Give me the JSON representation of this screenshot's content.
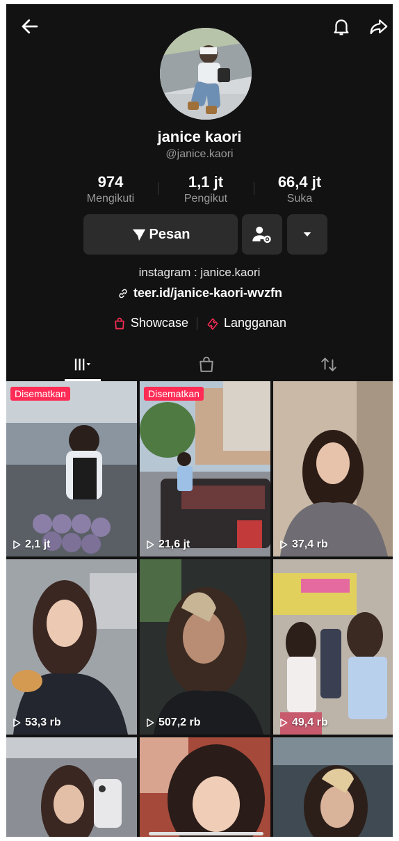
{
  "profile": {
    "name": "janice kaori",
    "handle": "@janice.kaori",
    "bio": "instagram : janice.kaori",
    "link": "teer.id/janice-kaori-wvzfn"
  },
  "stats": [
    {
      "value": "974",
      "label": "Mengikuti"
    },
    {
      "value": "1,1 jt",
      "label": "Pengikut"
    },
    {
      "value": "66,4 jt",
      "label": "Suka"
    }
  ],
  "actions": {
    "message": "Pesan"
  },
  "shop": {
    "showcase": "Showcase",
    "subscription": "Langganan"
  },
  "videos": [
    {
      "views": "2,1 jt",
      "pinned": "Disematkan"
    },
    {
      "views": "21,6 jt",
      "pinned": "Disematkan"
    },
    {
      "views": "37,4 rb"
    },
    {
      "views": "53,3 rb"
    },
    {
      "views": "507,2 rb"
    },
    {
      "views": "49,4 rb"
    },
    {
      "views": ""
    },
    {
      "views": ""
    },
    {
      "views": ""
    }
  ],
  "colors": {
    "background": "#121212",
    "accent": "#fe2c55",
    "button": "#2c2c2c"
  },
  "icons": [
    "back-arrow-icon",
    "bell-icon",
    "share-icon",
    "send-icon",
    "add-friend-icon",
    "chevron-down-icon",
    "link-icon",
    "shopping-bag-icon",
    "ticket-icon",
    "grid-icon",
    "repost-icon",
    "play-icon"
  ]
}
